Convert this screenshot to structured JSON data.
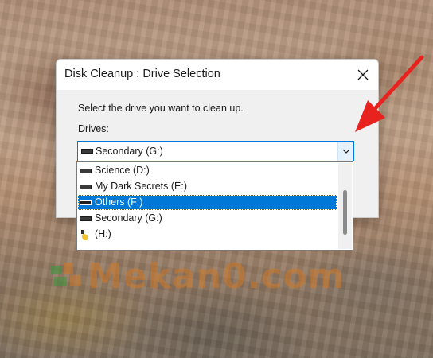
{
  "dialog": {
    "title": "Disk Cleanup : Drive Selection",
    "instruction": "Select the drive you want to clean up.",
    "drives_label": "Drives:",
    "selected_drive": "Secondary (G:)"
  },
  "dropdown": {
    "items": [
      {
        "label": "Science (D:)",
        "icon": "hard-drive-icon",
        "selected": false
      },
      {
        "label": "My Dark Secrets (E:)",
        "icon": "hard-drive-icon",
        "selected": false
      },
      {
        "label": "Others (F:)",
        "icon": "hard-drive-icon",
        "selected": true
      },
      {
        "label": "Secondary (G:)",
        "icon": "hard-drive-icon",
        "selected": false
      },
      {
        "label": "(H:)",
        "icon": "usb-drive-icon",
        "selected": false
      }
    ]
  },
  "watermark": {
    "text": "Mekan0.com"
  },
  "colors": {
    "accent": "#0078d7",
    "arrow": "#e8231f",
    "watermark": "#cd7828"
  }
}
